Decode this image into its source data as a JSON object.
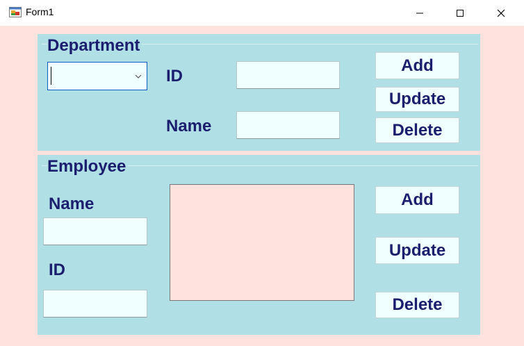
{
  "window": {
    "title": "Form1"
  },
  "department": {
    "group_title": "Department",
    "combo": {
      "value": ""
    },
    "id_label": "ID",
    "id_value": "",
    "name_label": "Name",
    "name_value": "",
    "add_label": "Add",
    "update_label": "Update",
    "delete_label": "Delete"
  },
  "employee": {
    "group_title": "Employee",
    "name_label": "Name",
    "name_value": "",
    "id_label": "ID",
    "id_value": "",
    "add_label": "Add",
    "update_label": "Update",
    "delete_label": "Delete"
  },
  "colors": {
    "form_bg": "#ffe1de",
    "group_bg": "#b0dfe5",
    "control_bg": "#f0ffff",
    "label_text": "#1b1e6e"
  },
  "icons": [
    "app-icon",
    "minimize-icon",
    "maximize-icon",
    "close-icon",
    "chevron-down-icon"
  ]
}
